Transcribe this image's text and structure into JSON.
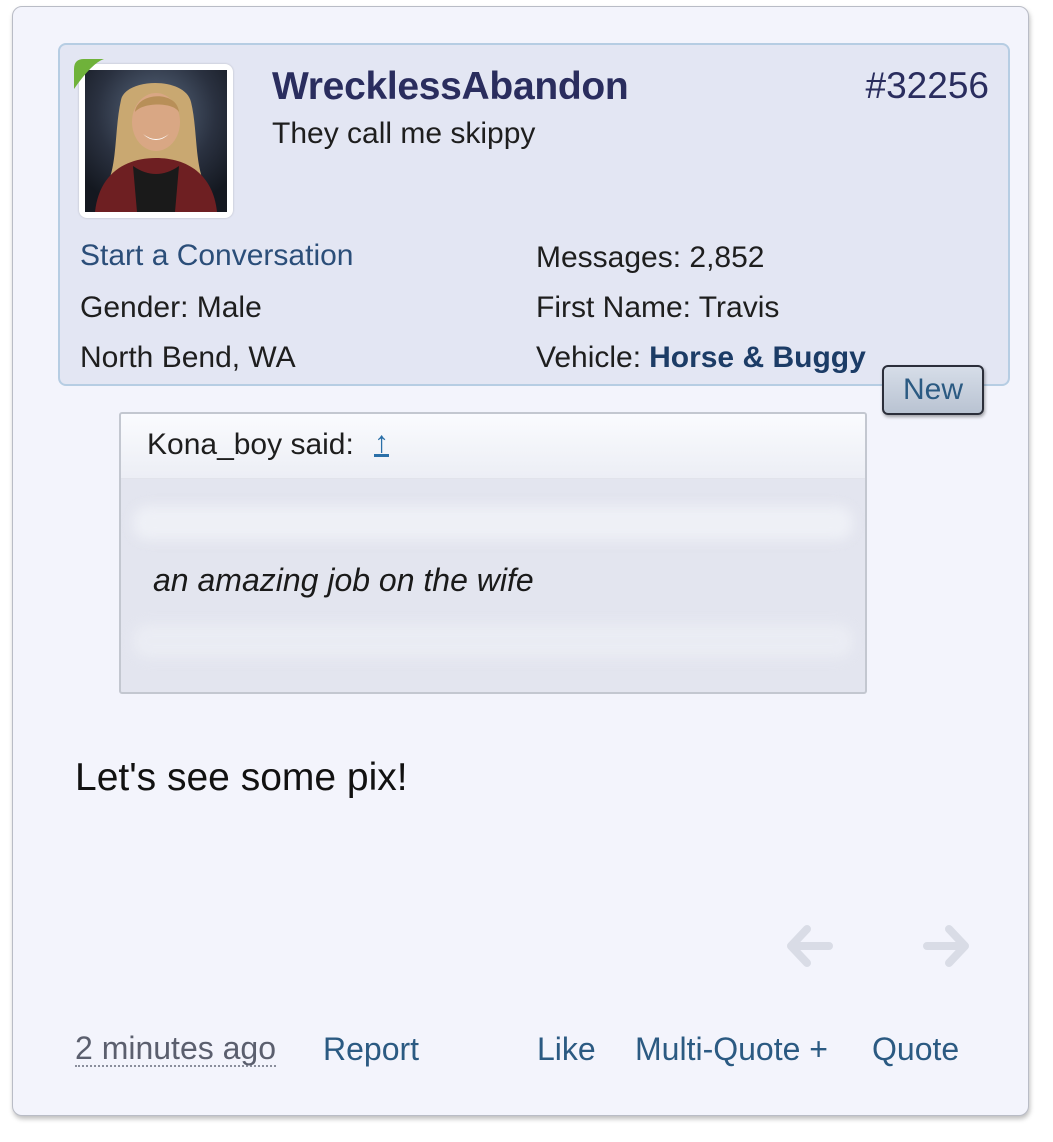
{
  "post": {
    "username": "WrecklessAbandon",
    "user_title": "They call me skippy",
    "post_number": "#32256",
    "start_conversation": "Start a Conversation",
    "gender": "Gender:  Male",
    "location": "North Bend, WA",
    "messages": "Messages:  2,852",
    "first_name": "First Name:  Travis",
    "vehicle_label": "Vehicle:",
    "vehicle_value": "Horse & Buggy",
    "new_badge": "New"
  },
  "quote": {
    "author_said": "Kona_boy said:",
    "jump_arrow": "↑",
    "text": "an amazing job on the wife"
  },
  "body": {
    "text": "Let's see some pix!"
  },
  "footer": {
    "time": "2 minutes ago",
    "report": "Report",
    "like": "Like",
    "multi_quote": "Multi-Quote +",
    "quote": "Quote"
  },
  "icons": {
    "prev": "arrow-left-icon",
    "next": "arrow-right-icon",
    "online": "online-indicator-icon"
  },
  "colors": {
    "username": "#2a2d5e",
    "link": "#2b5a82",
    "card_bg": "#f3f4fc",
    "userinfo_bg": "#e3e6f3",
    "online_green": "#6fb23a"
  }
}
